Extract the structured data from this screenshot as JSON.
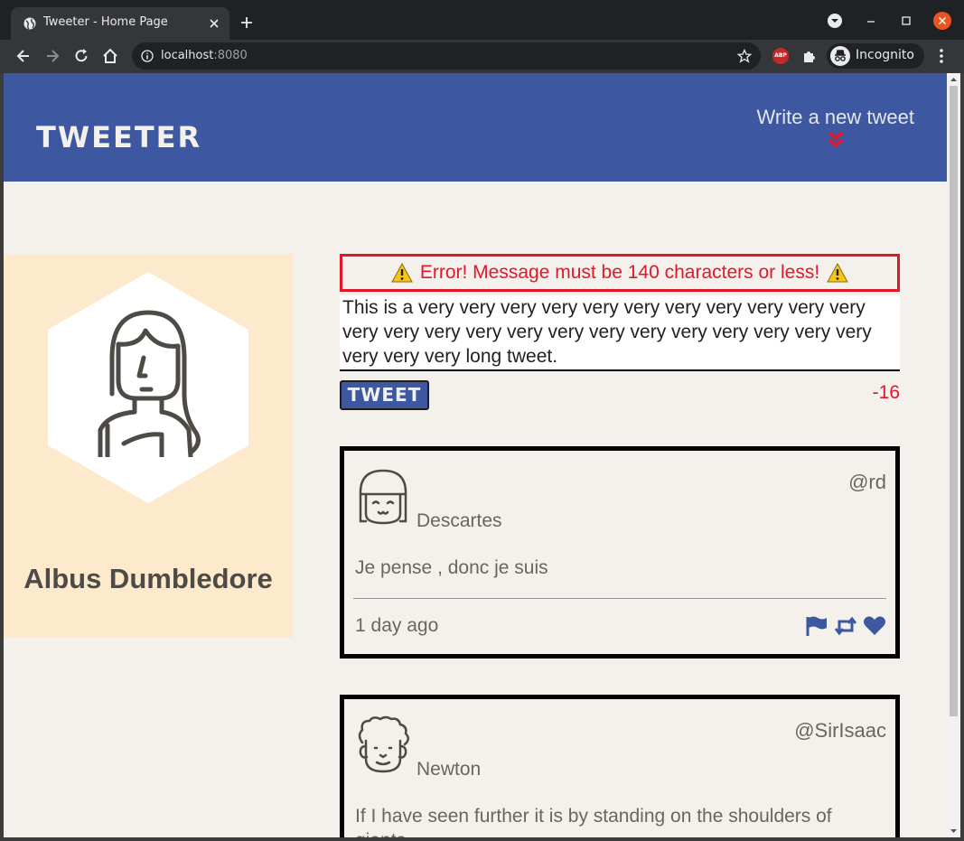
{
  "browser": {
    "tab_title": "Tweeter - Home Page",
    "url_host": "localhost",
    "url_port": ":8080",
    "profile_label": "Incognito",
    "extension_abp": "ABP"
  },
  "header": {
    "brand": "TWEETER",
    "write_new": "Write a new tweet"
  },
  "profile": {
    "name": "Albus Dumbledore"
  },
  "compose": {
    "error_message": "Error! Message must be 140 characters or less!",
    "text": "This is a very very very very very very very very very very very very very very very very very very very very very very very very very very very long tweet.",
    "button_label": "TWEET",
    "counter": "-16"
  },
  "tweets": [
    {
      "handle": "@rd",
      "name": "Descartes",
      "text": "Je pense , donc je suis",
      "time": "1 day ago"
    },
    {
      "handle": "@SirIsaac",
      "name": "Newton",
      "text": "If I have seen further it is by standing on the shoulders of giants"
    }
  ],
  "colors": {
    "header_bg": "#3d57a0",
    "page_bg": "#f4f1ec",
    "profile_bg": "#fde9cc",
    "error": "#e3162a",
    "accent_chevron": "#e3162a"
  },
  "icons": {
    "flag": "flag-icon",
    "retweet": "retweet-icon",
    "like": "heart-icon",
    "warning": "warning-icon"
  }
}
